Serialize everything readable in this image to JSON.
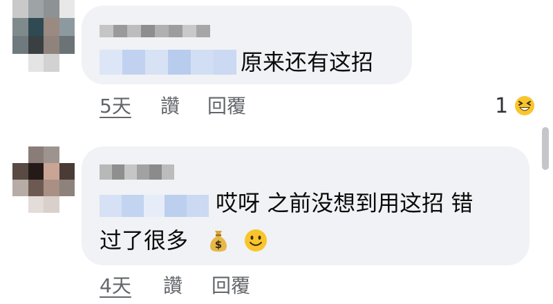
{
  "comments": [
    {
      "text_line1": "原来还有这招",
      "time": "5天",
      "like": "讚",
      "reply": "回覆",
      "reaction_count": "1",
      "reaction_icon": "laughing-face-icon"
    },
    {
      "text_line1": "哎呀 之前没想到用这招 错",
      "text_line2": "过了很多",
      "emojis": [
        "money-bag-icon",
        "smiley-face-icon"
      ],
      "time": "4天",
      "like": "讚",
      "reply": "回覆"
    }
  ],
  "colors": {
    "bubble": "#f0f2f5",
    "action_text": "#626569",
    "emoji_yellow": "#f8c52c"
  }
}
